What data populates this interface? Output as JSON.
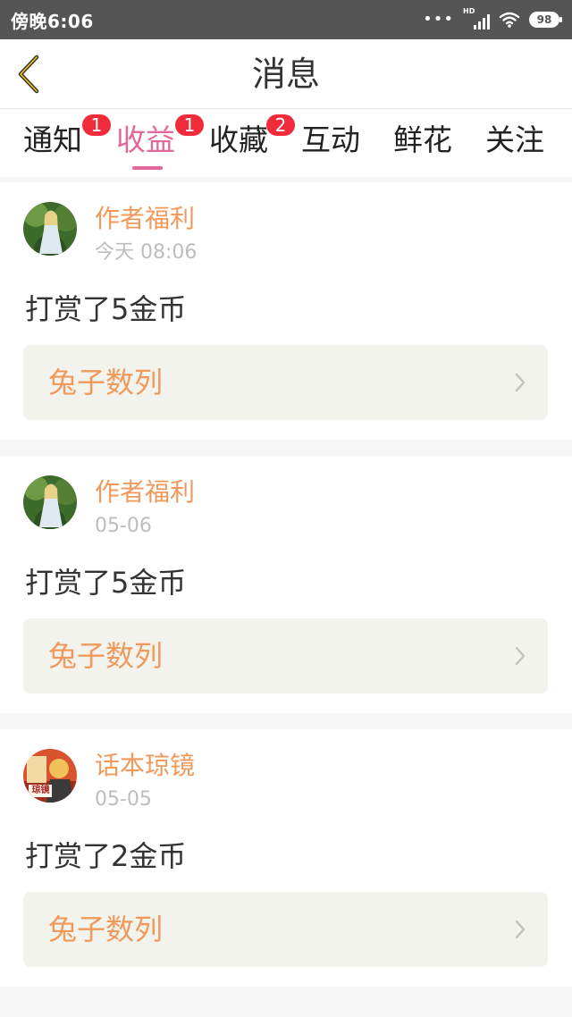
{
  "status": {
    "time": "傍晚6:06",
    "dots": "•••",
    "network": "HD",
    "battery": "98"
  },
  "header": {
    "title": "消息"
  },
  "tabs": [
    {
      "label": "通知",
      "badge": "1"
    },
    {
      "label": "收益",
      "badge": "1",
      "active": true
    },
    {
      "label": "收藏",
      "badge": "2"
    },
    {
      "label": "互动"
    },
    {
      "label": "鲜花"
    },
    {
      "label": "关注"
    }
  ],
  "messages": [
    {
      "sender": "作者福利",
      "time": "今天 08:06",
      "text": "打赏了5金币",
      "book": "兔子数列"
    },
    {
      "sender": "作者福利",
      "time": "05-06",
      "text": "打赏了5金币",
      "book": "兔子数列"
    },
    {
      "sender": "话本琼镜",
      "time": "05-05",
      "text": "打赏了2金币",
      "book": "兔子数列",
      "avatar_text": "琼镜"
    }
  ],
  "colors": {
    "accent": "#e0689a",
    "sender": "#f0995a",
    "badge": "#f02c3c",
    "status_bar": "#555555"
  }
}
